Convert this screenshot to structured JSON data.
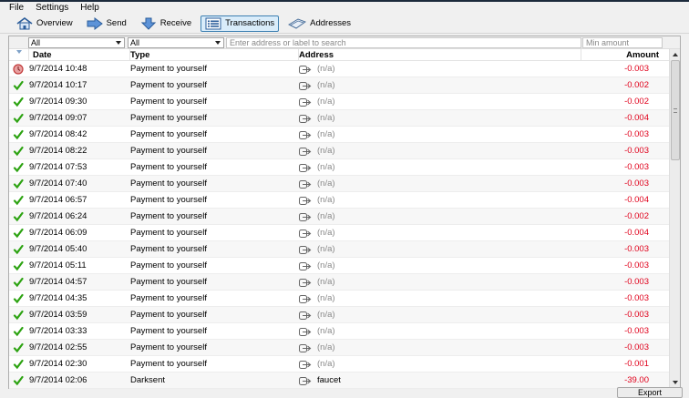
{
  "menu": {
    "file": "File",
    "settings": "Settings",
    "help": "Help"
  },
  "toolbar": {
    "overview": "Overview",
    "send": "Send",
    "receive": "Receive",
    "transactions": "Transactions",
    "addresses": "Addresses"
  },
  "filters": {
    "date_filter": "All",
    "type_filter": "All",
    "search_placeholder": "Enter address or label to search",
    "amount_placeholder": "Min amount"
  },
  "table": {
    "headers": {
      "date": "Date",
      "type": "Type",
      "address": "Address",
      "amount": "Amount"
    },
    "rows": [
      {
        "status": "unconfirmed",
        "date": "9/7/2014 10:48",
        "type": "Payment to yourself",
        "address": "(n/a)",
        "amount": "-0.003"
      },
      {
        "status": "confirmed",
        "date": "9/7/2014 10:17",
        "type": "Payment to yourself",
        "address": "(n/a)",
        "amount": "-0.002"
      },
      {
        "status": "confirmed",
        "date": "9/7/2014 09:30",
        "type": "Payment to yourself",
        "address": "(n/a)",
        "amount": "-0.002"
      },
      {
        "status": "confirmed",
        "date": "9/7/2014 09:07",
        "type": "Payment to yourself",
        "address": "(n/a)",
        "amount": "-0.004"
      },
      {
        "status": "confirmed",
        "date": "9/7/2014 08:42",
        "type": "Payment to yourself",
        "address": "(n/a)",
        "amount": "-0.003"
      },
      {
        "status": "confirmed",
        "date": "9/7/2014 08:22",
        "type": "Payment to yourself",
        "address": "(n/a)",
        "amount": "-0.003"
      },
      {
        "status": "confirmed",
        "date": "9/7/2014 07:53",
        "type": "Payment to yourself",
        "address": "(n/a)",
        "amount": "-0.003"
      },
      {
        "status": "confirmed",
        "date": "9/7/2014 07:40",
        "type": "Payment to yourself",
        "address": "(n/a)",
        "amount": "-0.003"
      },
      {
        "status": "confirmed",
        "date": "9/7/2014 06:57",
        "type": "Payment to yourself",
        "address": "(n/a)",
        "amount": "-0.004"
      },
      {
        "status": "confirmed",
        "date": "9/7/2014 06:24",
        "type": "Payment to yourself",
        "address": "(n/a)",
        "amount": "-0.002"
      },
      {
        "status": "confirmed",
        "date": "9/7/2014 06:09",
        "type": "Payment to yourself",
        "address": "(n/a)",
        "amount": "-0.004"
      },
      {
        "status": "confirmed",
        "date": "9/7/2014 05:40",
        "type": "Payment to yourself",
        "address": "(n/a)",
        "amount": "-0.003"
      },
      {
        "status": "confirmed",
        "date": "9/7/2014 05:11",
        "type": "Payment to yourself",
        "address": "(n/a)",
        "amount": "-0.003"
      },
      {
        "status": "confirmed",
        "date": "9/7/2014 04:57",
        "type": "Payment to yourself",
        "address": "(n/a)",
        "amount": "-0.003"
      },
      {
        "status": "confirmed",
        "date": "9/7/2014 04:35",
        "type": "Payment to yourself",
        "address": "(n/a)",
        "amount": "-0.003"
      },
      {
        "status": "confirmed",
        "date": "9/7/2014 03:59",
        "type": "Payment to yourself",
        "address": "(n/a)",
        "amount": "-0.003"
      },
      {
        "status": "confirmed",
        "date": "9/7/2014 03:33",
        "type": "Payment to yourself",
        "address": "(n/a)",
        "amount": "-0.003"
      },
      {
        "status": "confirmed",
        "date": "9/7/2014 02:55",
        "type": "Payment to yourself",
        "address": "(n/a)",
        "amount": "-0.003"
      },
      {
        "status": "confirmed",
        "date": "9/7/2014 02:30",
        "type": "Payment to yourself",
        "address": "(n/a)",
        "amount": "-0.001"
      },
      {
        "status": "confirmed",
        "date": "9/7/2014 02:06",
        "type": "Darksent",
        "address": "faucet",
        "amount": "-39.00"
      }
    ]
  },
  "colors": {
    "negative_amount": "#e0001b",
    "confirmed": "#2da312",
    "unconfirmed": "#c23b3b",
    "toolbar_active_border": "#3c7fb1"
  },
  "footer": {
    "export": "Export"
  }
}
